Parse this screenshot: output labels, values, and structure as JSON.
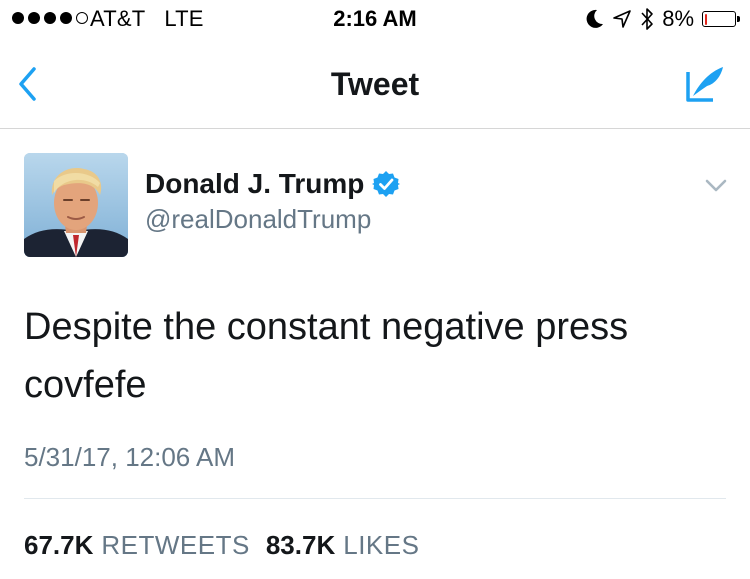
{
  "status_bar": {
    "carrier": "AT&T",
    "network": "LTE",
    "time": "2:16 AM",
    "battery_percent": "8%",
    "signal_bars_filled": 4,
    "signal_bars_total": 5,
    "battery_level": 0.08,
    "battery_color": "#e2271d",
    "icons": [
      "moon-icon",
      "location-arrow-icon",
      "bluetooth-icon",
      "battery-icon"
    ]
  },
  "nav": {
    "title": "Tweet",
    "back_icon": "chevron-left-icon",
    "compose_icon": "compose-quill-icon",
    "accent_color": "#1da1f2"
  },
  "tweet": {
    "display_name": "Donald J. Trump",
    "verified": true,
    "handle": "@realDonaldTrump",
    "text_line_1": "Despite the constant negative press",
    "text_line_2": "covfefe",
    "timestamp": "5/31/17, 12:06 AM",
    "retweets_count": "67.7K",
    "retweets_label": "RETWEETS",
    "likes_count": "83.7K",
    "likes_label": "LIKES",
    "more_icon": "chevron-down-icon"
  }
}
